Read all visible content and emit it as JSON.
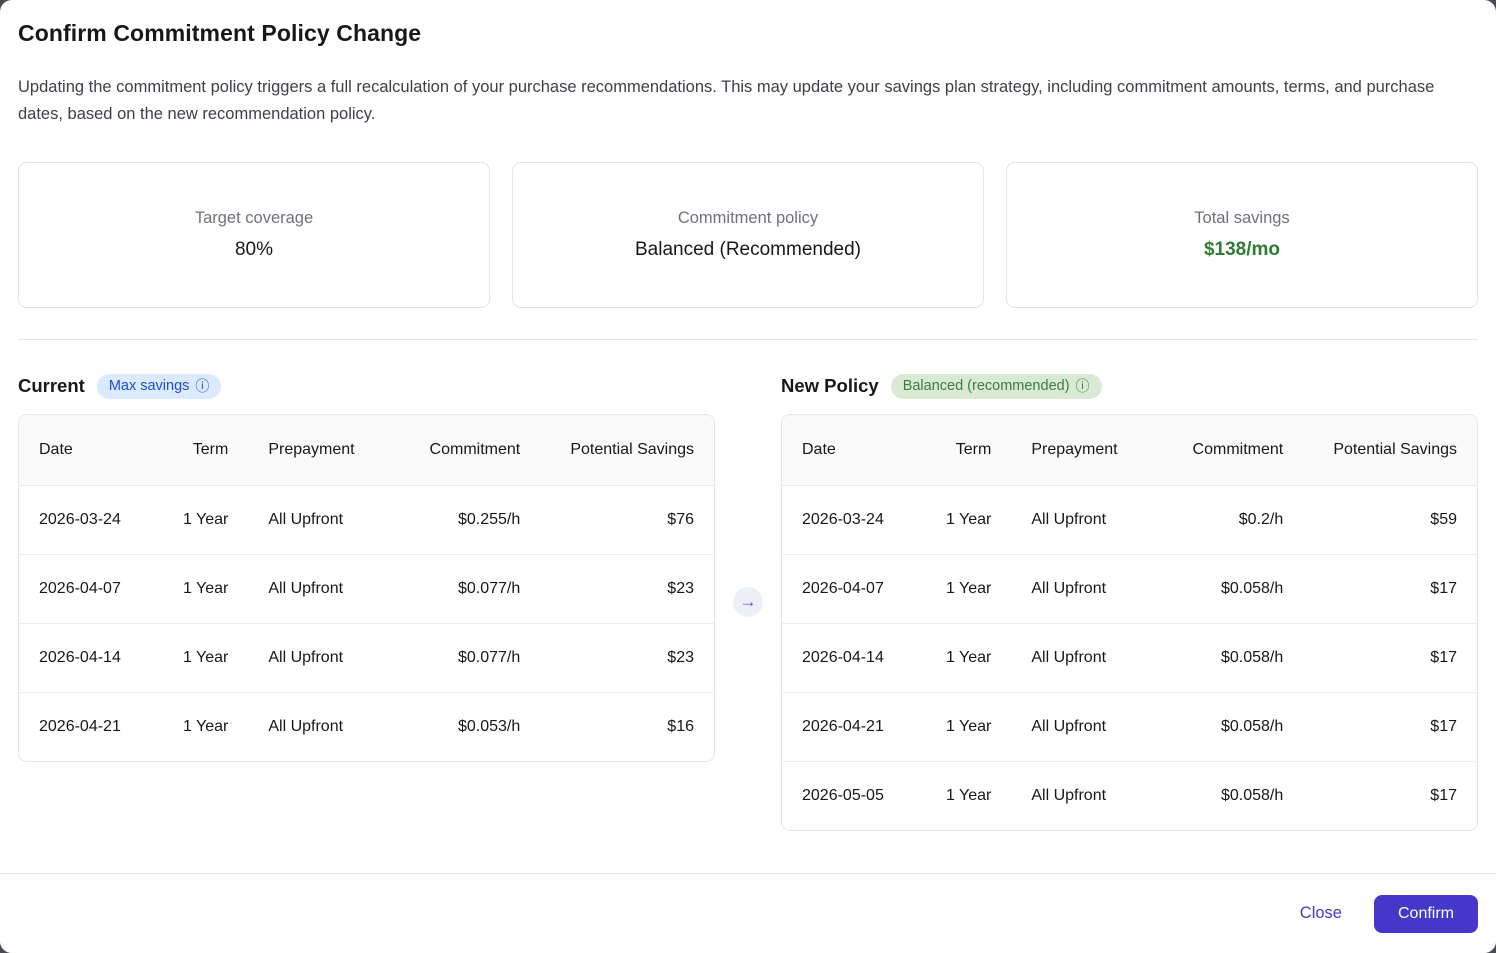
{
  "dialog": {
    "title": "Confirm Commitment Policy Change",
    "description": "Updating the commitment policy triggers a full recalculation of your purchase recommendations. This may update your savings plan strategy, including commitment amounts, terms, and purchase dates, based on the new recommendation policy.",
    "cards": [
      {
        "label": "Target coverage",
        "value": "80%"
      },
      {
        "label": "Commitment policy",
        "value": "Balanced (Recommended)"
      },
      {
        "label": "Total savings",
        "value": "$138/mo"
      }
    ],
    "current": {
      "heading": "Current",
      "badge": "Max savings",
      "columns": [
        "Date",
        "Term",
        "Prepayment",
        "Commitment",
        "Potential Savings"
      ],
      "rows": [
        [
          "2026-03-24",
          "1 Year",
          "All Upfront",
          "$0.255/h",
          "$76"
        ],
        [
          "2026-04-07",
          "1 Year",
          "All Upfront",
          "$0.077/h",
          "$23"
        ],
        [
          "2026-04-14",
          "1 Year",
          "All Upfront",
          "$0.077/h",
          "$23"
        ],
        [
          "2026-04-21",
          "1 Year",
          "All Upfront",
          "$0.053/h",
          "$16"
        ]
      ]
    },
    "new_policy": {
      "heading": "New Policy",
      "badge": "Balanced (recommended)",
      "columns": [
        "Date",
        "Term",
        "Prepayment",
        "Commitment",
        "Potential Savings"
      ],
      "rows": [
        [
          "2026-03-24",
          "1 Year",
          "All Upfront",
          "$0.2/h",
          "$59"
        ],
        [
          "2026-04-07",
          "1 Year",
          "All Upfront",
          "$0.058/h",
          "$17"
        ],
        [
          "2026-04-14",
          "1 Year",
          "All Upfront",
          "$0.058/h",
          "$17"
        ],
        [
          "2026-04-21",
          "1 Year",
          "All Upfront",
          "$0.058/h",
          "$17"
        ],
        [
          "2026-05-05",
          "1 Year",
          "All Upfront",
          "$0.058/h",
          "$17"
        ]
      ]
    },
    "footer": {
      "close_label": "Close",
      "confirm_label": "Confirm"
    }
  },
  "icons": {
    "info": "ⓘ",
    "arrow_right": "→"
  },
  "colors": {
    "accent_indigo": "#4338ca",
    "savings_green": "#2e7d32",
    "badge_blue_bg": "#dbeafe",
    "badge_blue_text": "#1d4ed8",
    "badge_green_bg": "#d9e9d4",
    "badge_green_text": "#3f7d42",
    "border_gray": "#e5e7eb",
    "header_bg": "#fafafa"
  }
}
